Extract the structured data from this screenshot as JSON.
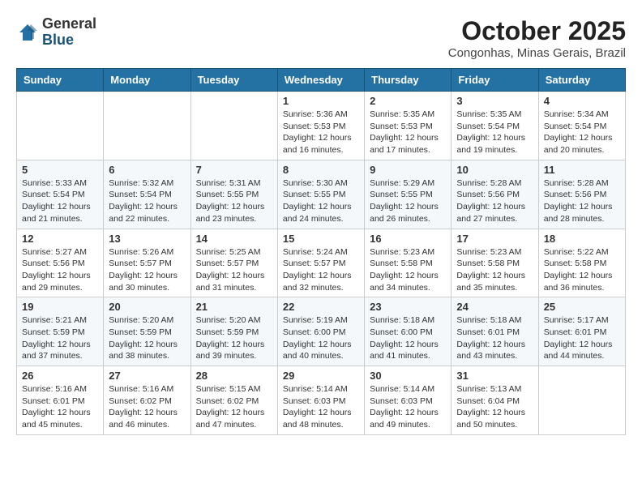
{
  "header": {
    "logo": {
      "general": "General",
      "blue": "Blue"
    },
    "title": "October 2025",
    "location": "Congonhas, Minas Gerais, Brazil"
  },
  "weekdays": [
    "Sunday",
    "Monday",
    "Tuesday",
    "Wednesday",
    "Thursday",
    "Friday",
    "Saturday"
  ],
  "weeks": [
    [
      {
        "day": "",
        "sunrise": "",
        "sunset": "",
        "daylight": ""
      },
      {
        "day": "",
        "sunrise": "",
        "sunset": "",
        "daylight": ""
      },
      {
        "day": "",
        "sunrise": "",
        "sunset": "",
        "daylight": ""
      },
      {
        "day": "1",
        "sunrise": "Sunrise: 5:36 AM",
        "sunset": "Sunset: 5:53 PM",
        "daylight": "Daylight: 12 hours and 16 minutes."
      },
      {
        "day": "2",
        "sunrise": "Sunrise: 5:35 AM",
        "sunset": "Sunset: 5:53 PM",
        "daylight": "Daylight: 12 hours and 17 minutes."
      },
      {
        "day": "3",
        "sunrise": "Sunrise: 5:35 AM",
        "sunset": "Sunset: 5:54 PM",
        "daylight": "Daylight: 12 hours and 19 minutes."
      },
      {
        "day": "4",
        "sunrise": "Sunrise: 5:34 AM",
        "sunset": "Sunset: 5:54 PM",
        "daylight": "Daylight: 12 hours and 20 minutes."
      }
    ],
    [
      {
        "day": "5",
        "sunrise": "Sunrise: 5:33 AM",
        "sunset": "Sunset: 5:54 PM",
        "daylight": "Daylight: 12 hours and 21 minutes."
      },
      {
        "day": "6",
        "sunrise": "Sunrise: 5:32 AM",
        "sunset": "Sunset: 5:54 PM",
        "daylight": "Daylight: 12 hours and 22 minutes."
      },
      {
        "day": "7",
        "sunrise": "Sunrise: 5:31 AM",
        "sunset": "Sunset: 5:55 PM",
        "daylight": "Daylight: 12 hours and 23 minutes."
      },
      {
        "day": "8",
        "sunrise": "Sunrise: 5:30 AM",
        "sunset": "Sunset: 5:55 PM",
        "daylight": "Daylight: 12 hours and 24 minutes."
      },
      {
        "day": "9",
        "sunrise": "Sunrise: 5:29 AM",
        "sunset": "Sunset: 5:55 PM",
        "daylight": "Daylight: 12 hours and 26 minutes."
      },
      {
        "day": "10",
        "sunrise": "Sunrise: 5:28 AM",
        "sunset": "Sunset: 5:56 PM",
        "daylight": "Daylight: 12 hours and 27 minutes."
      },
      {
        "day": "11",
        "sunrise": "Sunrise: 5:28 AM",
        "sunset": "Sunset: 5:56 PM",
        "daylight": "Daylight: 12 hours and 28 minutes."
      }
    ],
    [
      {
        "day": "12",
        "sunrise": "Sunrise: 5:27 AM",
        "sunset": "Sunset: 5:56 PM",
        "daylight": "Daylight: 12 hours and 29 minutes."
      },
      {
        "day": "13",
        "sunrise": "Sunrise: 5:26 AM",
        "sunset": "Sunset: 5:57 PM",
        "daylight": "Daylight: 12 hours and 30 minutes."
      },
      {
        "day": "14",
        "sunrise": "Sunrise: 5:25 AM",
        "sunset": "Sunset: 5:57 PM",
        "daylight": "Daylight: 12 hours and 31 minutes."
      },
      {
        "day": "15",
        "sunrise": "Sunrise: 5:24 AM",
        "sunset": "Sunset: 5:57 PM",
        "daylight": "Daylight: 12 hours and 32 minutes."
      },
      {
        "day": "16",
        "sunrise": "Sunrise: 5:23 AM",
        "sunset": "Sunset: 5:58 PM",
        "daylight": "Daylight: 12 hours and 34 minutes."
      },
      {
        "day": "17",
        "sunrise": "Sunrise: 5:23 AM",
        "sunset": "Sunset: 5:58 PM",
        "daylight": "Daylight: 12 hours and 35 minutes."
      },
      {
        "day": "18",
        "sunrise": "Sunrise: 5:22 AM",
        "sunset": "Sunset: 5:58 PM",
        "daylight": "Daylight: 12 hours and 36 minutes."
      }
    ],
    [
      {
        "day": "19",
        "sunrise": "Sunrise: 5:21 AM",
        "sunset": "Sunset: 5:59 PM",
        "daylight": "Daylight: 12 hours and 37 minutes."
      },
      {
        "day": "20",
        "sunrise": "Sunrise: 5:20 AM",
        "sunset": "Sunset: 5:59 PM",
        "daylight": "Daylight: 12 hours and 38 minutes."
      },
      {
        "day": "21",
        "sunrise": "Sunrise: 5:20 AM",
        "sunset": "Sunset: 5:59 PM",
        "daylight": "Daylight: 12 hours and 39 minutes."
      },
      {
        "day": "22",
        "sunrise": "Sunrise: 5:19 AM",
        "sunset": "Sunset: 6:00 PM",
        "daylight": "Daylight: 12 hours and 40 minutes."
      },
      {
        "day": "23",
        "sunrise": "Sunrise: 5:18 AM",
        "sunset": "Sunset: 6:00 PM",
        "daylight": "Daylight: 12 hours and 41 minutes."
      },
      {
        "day": "24",
        "sunrise": "Sunrise: 5:18 AM",
        "sunset": "Sunset: 6:01 PM",
        "daylight": "Daylight: 12 hours and 43 minutes."
      },
      {
        "day": "25",
        "sunrise": "Sunrise: 5:17 AM",
        "sunset": "Sunset: 6:01 PM",
        "daylight": "Daylight: 12 hours and 44 minutes."
      }
    ],
    [
      {
        "day": "26",
        "sunrise": "Sunrise: 5:16 AM",
        "sunset": "Sunset: 6:01 PM",
        "daylight": "Daylight: 12 hours and 45 minutes."
      },
      {
        "day": "27",
        "sunrise": "Sunrise: 5:16 AM",
        "sunset": "Sunset: 6:02 PM",
        "daylight": "Daylight: 12 hours and 46 minutes."
      },
      {
        "day": "28",
        "sunrise": "Sunrise: 5:15 AM",
        "sunset": "Sunset: 6:02 PM",
        "daylight": "Daylight: 12 hours and 47 minutes."
      },
      {
        "day": "29",
        "sunrise": "Sunrise: 5:14 AM",
        "sunset": "Sunset: 6:03 PM",
        "daylight": "Daylight: 12 hours and 48 minutes."
      },
      {
        "day": "30",
        "sunrise": "Sunrise: 5:14 AM",
        "sunset": "Sunset: 6:03 PM",
        "daylight": "Daylight: 12 hours and 49 minutes."
      },
      {
        "day": "31",
        "sunrise": "Sunrise: 5:13 AM",
        "sunset": "Sunset: 6:04 PM",
        "daylight": "Daylight: 12 hours and 50 minutes."
      },
      {
        "day": "",
        "sunrise": "",
        "sunset": "",
        "daylight": ""
      }
    ]
  ]
}
